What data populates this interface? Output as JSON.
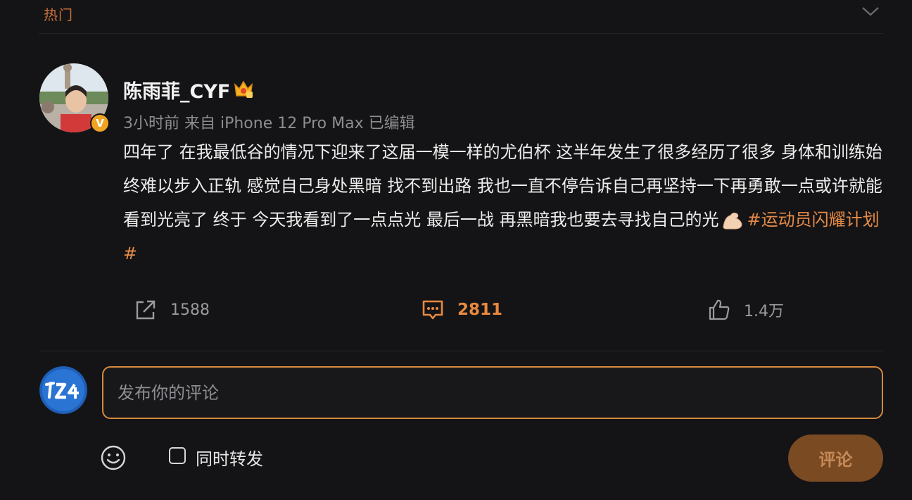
{
  "top_tab": {
    "label": "热门"
  },
  "post": {
    "username": "陈雨菲_CYF",
    "verified_badge": "V",
    "meta": "3小时前 来自 iPhone 12 Pro Max 已编辑",
    "text": "四年了 在我最低谷的情况下迎来了这届一模一样的尤伯杯 这半年发生了很多经历了很多 身体和训练始终难以步入正轨 感觉自己身处黑暗 找不到出路 我也一直不停告诉自己再坚持一下再勇敢一点或许就能看到光亮了 终于 今天我看到了一点点光 最后一战 再黑暗我也要去寻找自己的光",
    "hashtag": "#运动员闪耀计划#"
  },
  "actions": {
    "repost_count": "1588",
    "comment_count": "2811",
    "like_count": "1.4万"
  },
  "composer": {
    "placeholder": "发布你的评论",
    "repost_label": "同时转发",
    "submit_label": "评论"
  },
  "colors": {
    "background": "#141416",
    "accent": "#e58a47",
    "input_border": "#d78a3e",
    "submit_bg": "#7a4a22"
  },
  "icons": [
    "chevron-down-icon",
    "crown-badge-icon",
    "flexed-biceps-emoji",
    "repost-icon",
    "comment-icon",
    "like-icon",
    "emoji-icon"
  ]
}
